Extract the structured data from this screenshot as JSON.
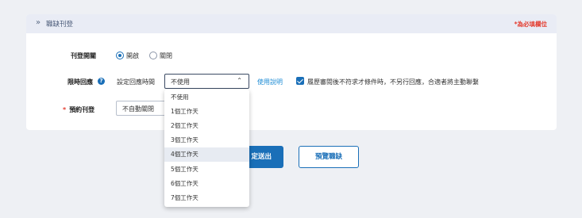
{
  "section": {
    "title": "職缺刊登",
    "required_note": "*為必填欄位",
    "chevron_glyph": "»"
  },
  "publish_toggle": {
    "label": "刊登開關",
    "options": [
      "開啟",
      "關閉"
    ],
    "selected": "開啟"
  },
  "reply_limit": {
    "label": "限時回應",
    "help_glyph": "?",
    "sublabel": "設定回應時間",
    "select_value": "不使用",
    "caret_glyph": "⌃",
    "help_link": "使用說明",
    "checkbox_checked": true,
    "checkbox_label": "履歷審閱後不符求才條件時，不另行回應，合適者將主動聯繫"
  },
  "scheduled_publish": {
    "label": "預約刊登",
    "required_mark": "*",
    "select_value": "不自動關閉"
  },
  "dropdown": {
    "options": [
      "不使用",
      "1個工作天",
      "2個工作天",
      "3個工作天",
      "4個工作天",
      "5個工作天",
      "6個工作天",
      "7個工作天"
    ],
    "highlighted": "4個工作天"
  },
  "actions": {
    "submit_label": "定送出",
    "preview_label": "預覽職缺"
  },
  "colors": {
    "accent": "#1a6fb8",
    "link": "#1a8ad4",
    "required": "#e43d30",
    "header_bg": "#e9ecf5",
    "page_bg": "#eef0f4"
  }
}
